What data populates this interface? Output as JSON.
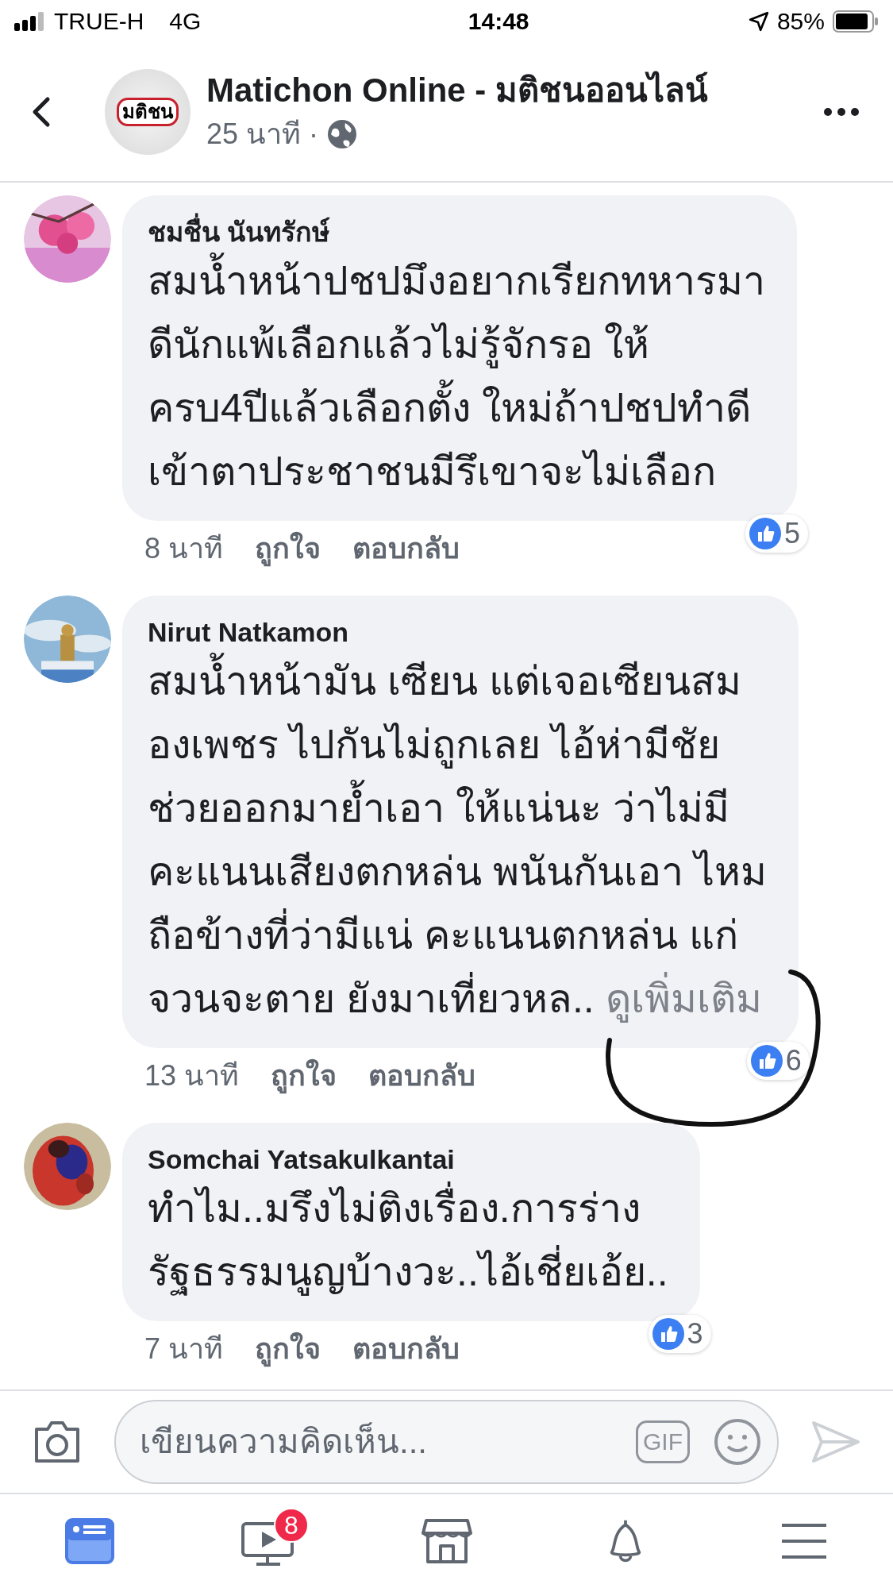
{
  "status_bar": {
    "carrier": "TRUE-H",
    "network": "4G",
    "time": "14:48",
    "battery": "85%"
  },
  "header": {
    "logo_text": "มติชน",
    "title": "Matichon Online - มติชนออนไลน์",
    "time": "25 นาที",
    "separator": "·"
  },
  "comments": [
    {
      "author": "ชมชื่น นันทรักษ์",
      "lines": [
        "สมน้ำหน้าปชปมึงอยากเรียกทหารมา",
        "ดีนักแพ้เลือกแล้วไม่รู้จักรอ ให้",
        "ครบ4ปีแล้วเลือกตั้ง ใหม่ถ้าปชปทำดี",
        "เข้าตาประชาชนมีรึเขาจะไม่เลือก"
      ],
      "time": "8 นาที",
      "like": "ถูกใจ",
      "reply": "ตอบกลับ",
      "likes": "5"
    },
    {
      "author": "Nirut Natkamon",
      "lines": [
        "สมน้ำหน้ามัน เซียน แต่เจอเซียนสม",
        "องเพชร ไปกันไม่ถูกเลย ไอ้ห่ามีชัย",
        "ช่วยออกมาย้ำเอา ให้แน่นะ ว่าไม่มี",
        "คะแนนเสียงตกหล่น พนันกันเอา ไหม",
        "ถือข้างที่ว่ามีแน่ คะแนนตกหล่น แก่",
        "จวนจะตาย ยังมาเที่ยวหล.."
      ],
      "see_more": "ดูเพิ่มเติม",
      "time": "13 นาที",
      "like": "ถูกใจ",
      "reply": "ตอบกลับ",
      "likes": "6",
      "annotated": true
    },
    {
      "author": "Somchai Yatsakulkantai",
      "lines": [
        "ทำไม..มรึงไม่ติงเรื่อง.การร่าง",
        "รัฐธรรมนูญบ้างวะ..ไอ้เชี่ยเอ้ย.."
      ],
      "time": "7 นาที",
      "like": "ถูกใจ",
      "reply": "ตอบกลับ",
      "likes": "3"
    }
  ],
  "composer": {
    "placeholder": "เขียนความคิดเห็น...",
    "gif": "GIF"
  },
  "tabs": [
    {
      "kind": "feed",
      "selected": true
    },
    {
      "kind": "video",
      "selected": false,
      "badge": "8"
    },
    {
      "kind": "market",
      "selected": false
    },
    {
      "kind": "bell",
      "selected": false
    },
    {
      "kind": "menu",
      "selected": false
    }
  ]
}
